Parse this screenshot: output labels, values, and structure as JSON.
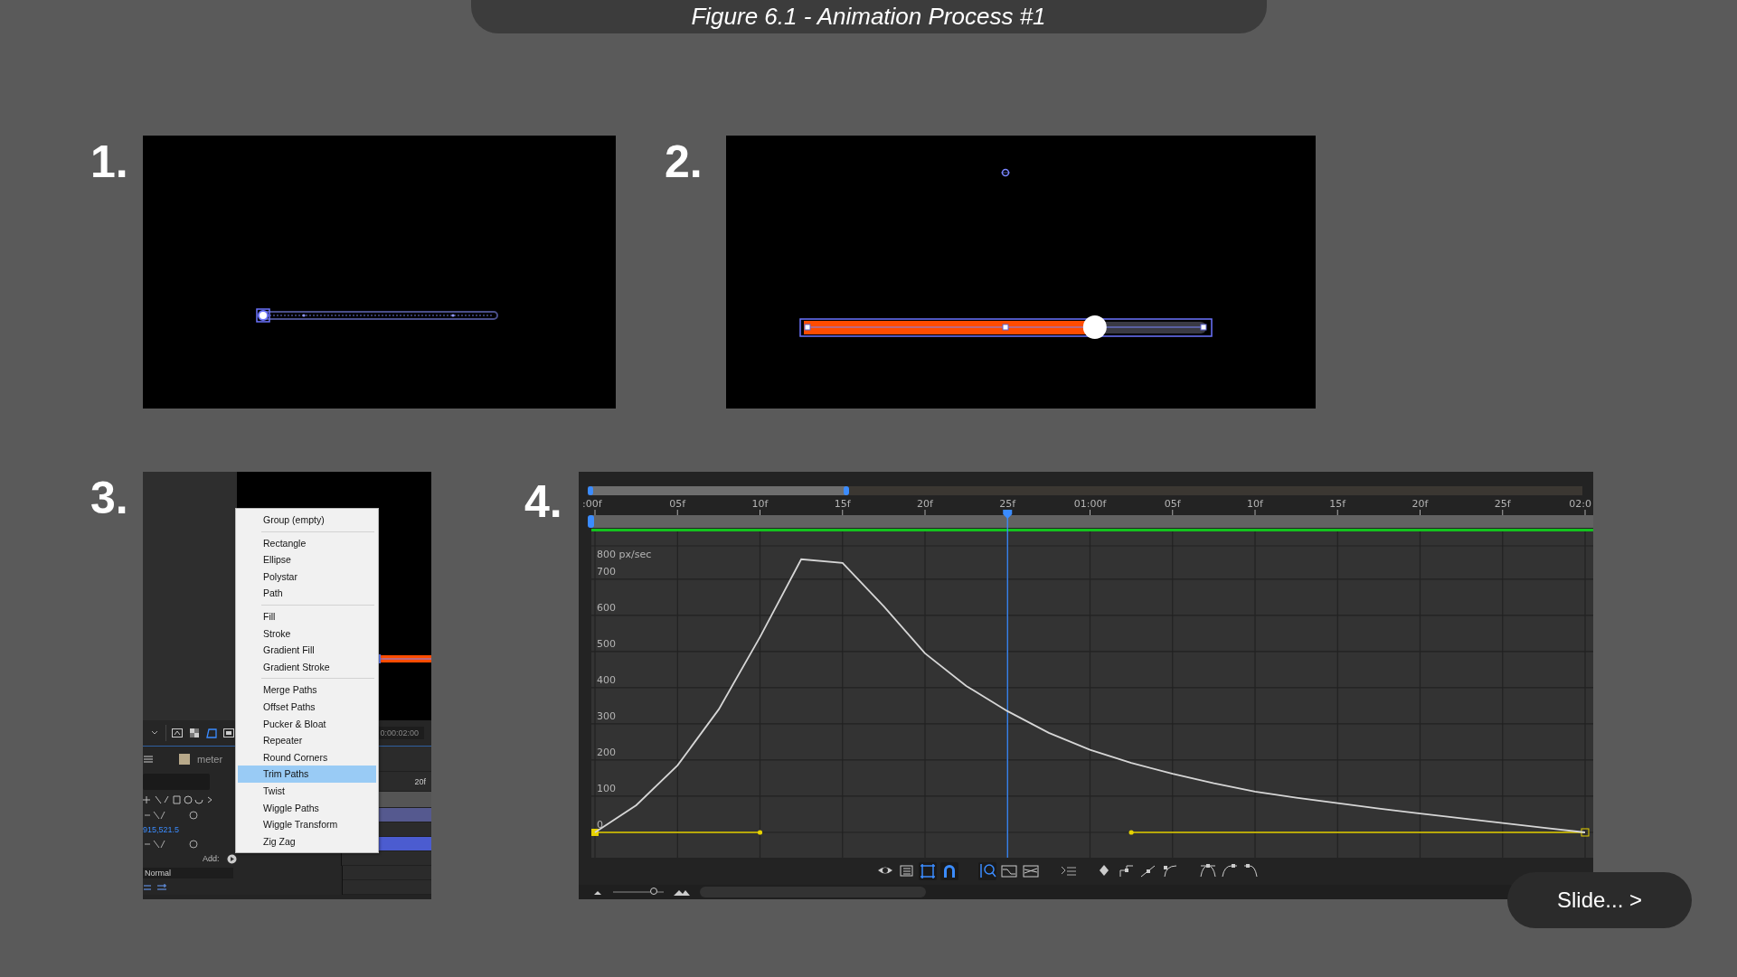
{
  "title": "Figure 6.1 - Animation Process #1",
  "step_1": {
    "number": "1."
  },
  "step_2": {
    "number": "2.",
    "bar": {
      "level": 0.72
    }
  },
  "step_3": {
    "number": "3.",
    "timecode": "0:00:02:00",
    "tab_label": "meter",
    "ruler_label": "20f",
    "position_value": "915,521.5",
    "add_label": "Add:",
    "blend_mode": "Normal",
    "menu": {
      "groups": [
        [
          {
            "label": "Group (empty)",
            "selected": false
          }
        ],
        [
          {
            "label": "Rectangle",
            "selected": false
          },
          {
            "label": "Ellipse",
            "selected": false
          },
          {
            "label": "Polystar",
            "selected": false
          },
          {
            "label": "Path",
            "selected": false
          }
        ],
        [
          {
            "label": "Fill",
            "selected": false
          },
          {
            "label": "Stroke",
            "selected": false
          },
          {
            "label": "Gradient Fill",
            "selected": false
          },
          {
            "label": "Gradient Stroke",
            "selected": false
          }
        ],
        [
          {
            "label": "Merge Paths",
            "selected": false
          },
          {
            "label": "Offset Paths",
            "selected": false
          },
          {
            "label": "Pucker & Bloat",
            "selected": false
          },
          {
            "label": "Repeater",
            "selected": false
          },
          {
            "label": "Round Corners",
            "selected": false
          },
          {
            "label": "Trim Paths",
            "selected": true
          },
          {
            "label": "Twist",
            "selected": false
          },
          {
            "label": "Wiggle Paths",
            "selected": false
          },
          {
            "label": "Wiggle Transform",
            "selected": false
          },
          {
            "label": "Zig Zag",
            "selected": false
          }
        ]
      ]
    }
  },
  "step_4": {
    "number": "4.",
    "zoom_slider": {
      "level": 0.8
    },
    "chart_data": {
      "type": "line",
      "ylabel": "800 px/sec",
      "categories": [
        ":00f",
        null,
        "05f",
        null,
        "10f",
        null,
        "15f",
        null,
        "20f",
        null,
        "25f",
        null,
        "01:00f",
        null,
        "05f",
        null,
        "10f",
        null,
        "15f",
        null,
        "20f",
        null,
        "25f",
        null,
        "02:0"
      ],
      "series": [
        {
          "color": "#d6d6d6",
          "values": [
            0,
            75,
            185,
            340,
            540,
            755,
            745,
            625,
            495,
            405,
            335,
            275,
            228,
            192,
            162,
            136,
            113,
            96,
            81,
            66,
            52,
            39,
            26,
            13,
            0
          ]
        },
        {
          "color": "#e6d200",
          "values": [
            0,
            0,
            0,
            0,
            0,
            null,
            null,
            null,
            null,
            null,
            null,
            null,
            null,
            0,
            0,
            0,
            0,
            0,
            0,
            0,
            0,
            0,
            0,
            0,
            0
          ]
        }
      ],
      "ylim": [
        -70,
        832
      ],
      "yticks": [
        0,
        100,
        200,
        300,
        400,
        500,
        600,
        700
      ],
      "grid": true,
      "ref_lines": [
        {
          "axis": "x",
          "value": "25f",
          "color": "#3b8cff"
        }
      ]
    }
  },
  "next_button": {
    "label": "Slide... >"
  }
}
